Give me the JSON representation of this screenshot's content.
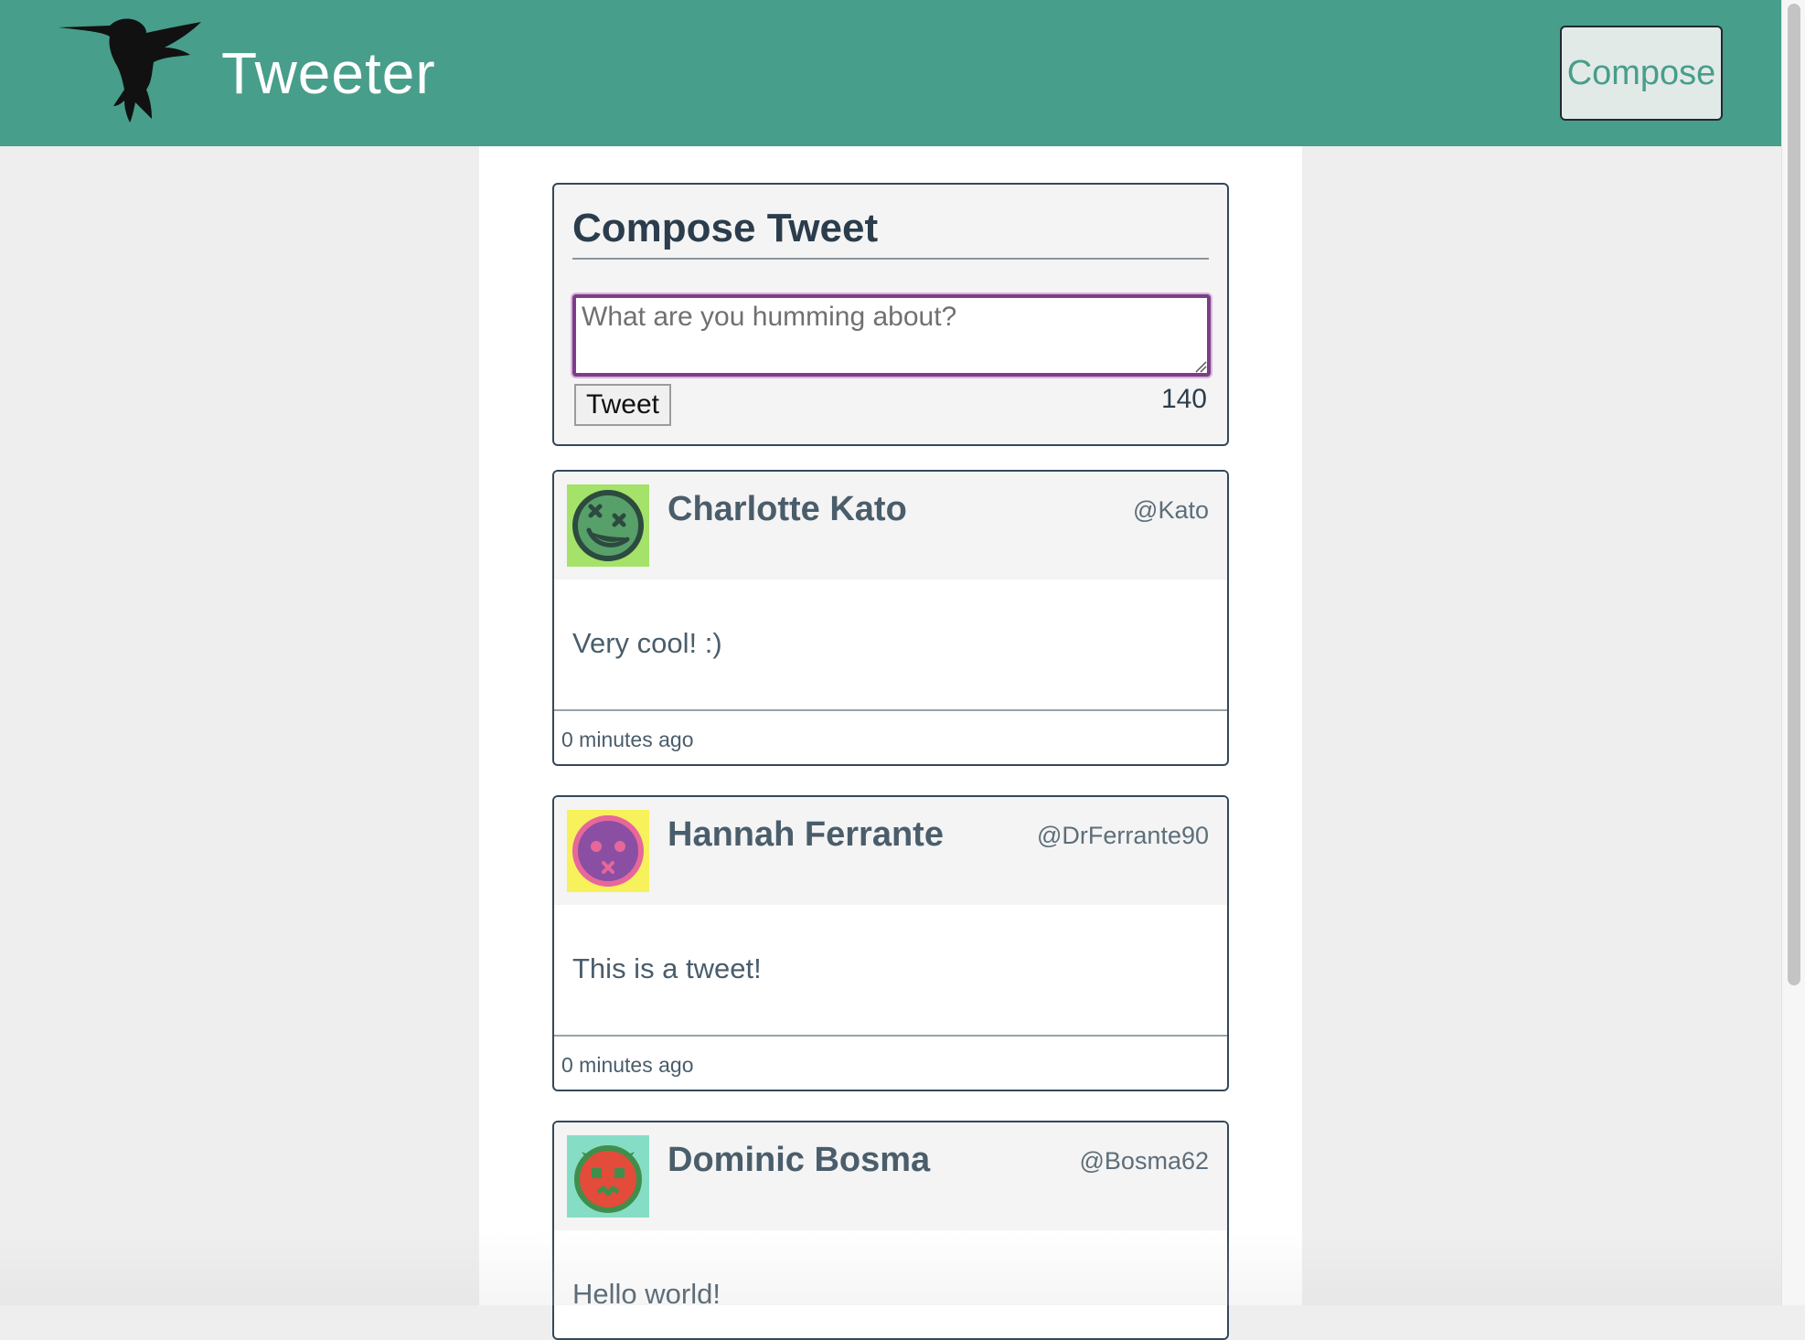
{
  "navbar": {
    "brand": "Tweeter",
    "compose_label": "Compose",
    "logo_icon": "hummingbird-icon"
  },
  "compose": {
    "title": "Compose Tweet",
    "placeholder": "What are you humming about?",
    "value": "",
    "button_label": "Tweet",
    "counter": "140"
  },
  "tweets": [
    {
      "name": "Charlotte Kato",
      "handle": "@Kato",
      "text": "Very cool! :)",
      "time": "0 minutes ago",
      "avatar_icon": "dizzy-face-avatar-icon",
      "avatar_colors": {
        "background": "#a4e26a",
        "face": "#57a06a"
      }
    },
    {
      "name": "Hannah Ferrante",
      "handle": "@DrFerrante90",
      "text": "This is a tweet!",
      "time": "0 minutes ago",
      "avatar_icon": "purple-face-avatar-icon",
      "avatar_colors": {
        "background": "#f7f15c",
        "face": "#8a4fa2"
      }
    },
    {
      "name": "Dominic Bosma",
      "handle": "@Bosma62",
      "text": "Hello world!",
      "time": "",
      "avatar_icon": "red-monster-avatar-icon",
      "avatar_colors": {
        "background": "#86ddc6",
        "face": "#e34b3b"
      }
    }
  ],
  "colors": {
    "navbar": "#479e8a",
    "accent": "#479e8a",
    "page_background": "#eeeeee",
    "textarea_focus_border": "#7b3f87"
  }
}
